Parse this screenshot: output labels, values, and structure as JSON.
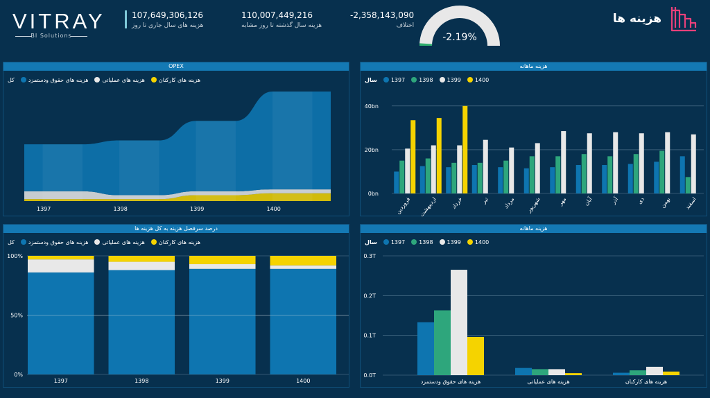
{
  "header": {
    "logo_text": "VITRAY",
    "logo_sub": "BI Solutions",
    "page_title": "هزینه ها",
    "kpis": [
      {
        "value": "107,649,306,126",
        "label": "هزینه های سال جاری تا روز"
      },
      {
        "value": "110,007,449,216",
        "label": "هزینه سال گذشته تا روز مشابه"
      },
      {
        "value": "-2,358,143,090",
        "label": "اختلاف"
      }
    ],
    "gauge": {
      "value_text": "-2.19%",
      "fill_fraction": 0.02,
      "track_color": "#e8e8e8",
      "fill_color": "#2fae6f"
    }
  },
  "colors": {
    "p1397": "#0e75b0",
    "p1398": "#2ea67c",
    "p1399": "#e8e8e8",
    "p1400": "#f5d300",
    "salary": "#0e75b0",
    "ops": "#e8e8e8",
    "staff": "#f5d300"
  },
  "opex": {
    "title": "OPEX",
    "legend": [
      {
        "label": "کل",
        "color": ""
      },
      {
        "label": "هزینه های حقوق ودستمزد",
        "color": "#0e75b0"
      },
      {
        "label": "هزینه های عملیاتی",
        "color": "#e8e8e8"
      },
      {
        "label": "هزینه های کارکنان",
        "color": "#f5d300"
      }
    ],
    "chart_data": {
      "type": "area",
      "categories": [
        "1397",
        "1398",
        "1399",
        "1400"
      ],
      "series": [
        {
          "name": "هزینه های حقوق ودستمزد",
          "values": [
            0.12,
            0.14,
            0.18,
            0.25
          ]
        },
        {
          "name": "هزینه های عملیاتی",
          "values": [
            0.02,
            0.01,
            0.01,
            0.01
          ]
        },
        {
          "name": "هزینه های کارکنان",
          "values": [
            0.005,
            0.005,
            0.015,
            0.02
          ]
        }
      ]
    }
  },
  "monthly1": {
    "title": "هزینه ماهانه",
    "legend_title": "سال",
    "legend": [
      {
        "label": "1397",
        "color": "#0e75b0"
      },
      {
        "label": "1398",
        "color": "#2ea67c"
      },
      {
        "label": "1399",
        "color": "#e8e8e8"
      },
      {
        "label": "1400",
        "color": "#f5d300"
      }
    ],
    "chart_data": {
      "type": "bar",
      "categories": [
        "فروردین",
        "اردیبهشت",
        "خرداد",
        "تیر",
        "مرداد",
        "شهریور",
        "مهر",
        "آبان",
        "آذر",
        "دی",
        "بهمن",
        "اسفند"
      ],
      "series": [
        {
          "name": "1397",
          "values": [
            10,
            12.5,
            12,
            13,
            12,
            11.5,
            12,
            13,
            13,
            13.5,
            14.5,
            17
          ]
        },
        {
          "name": "1398",
          "values": [
            15,
            16,
            14,
            14,
            15,
            17,
            17,
            18,
            17,
            18,
            19.5,
            7.5
          ]
        },
        {
          "name": "1399",
          "values": [
            20.5,
            22,
            22,
            24.5,
            21,
            23,
            28.5,
            27.5,
            28,
            27.5,
            28,
            27
          ]
        },
        {
          "name": "1400",
          "values": [
            33.5,
            34.5,
            40,
            0,
            0,
            0,
            0,
            0,
            0,
            0,
            0,
            0
          ]
        }
      ],
      "yticks": [
        "0bn",
        "20bn",
        "40bn"
      ],
      "ylim": [
        0,
        45
      ]
    }
  },
  "percent": {
    "title": "درصد سرفصل هزینه به کل هزینه ها",
    "legend": [
      {
        "label": "کل",
        "color": ""
      },
      {
        "label": "هزینه های حقوق ودستمزد",
        "color": "#0e75b0"
      },
      {
        "label": "هزینه های عملیاتی",
        "color": "#e8e8e8"
      },
      {
        "label": "هزینه های کارکنان",
        "color": "#f5d300"
      }
    ],
    "chart_data": {
      "type": "bar",
      "categories": [
        "1397",
        "1398",
        "1399",
        "1400"
      ],
      "series": [
        {
          "name": "هزینه های حقوق ودستمزد",
          "values": [
            86,
            88,
            89,
            89
          ]
        },
        {
          "name": "هزینه های عملیاتی",
          "values": [
            11,
            7,
            4,
            3
          ]
        },
        {
          "name": "هزینه های کارکنان",
          "values": [
            3,
            5,
            7,
            8
          ]
        }
      ],
      "yticks": [
        "0%",
        "50%",
        "100%"
      ]
    }
  },
  "monthly2": {
    "title": "هزینه ماهانه",
    "legend_title": "سال",
    "legend": [
      {
        "label": "1397",
        "color": "#0e75b0"
      },
      {
        "label": "1398",
        "color": "#2ea67c"
      },
      {
        "label": "1399",
        "color": "#e8e8e8"
      },
      {
        "label": "1400",
        "color": "#f5d300"
      }
    ],
    "chart_data": {
      "type": "bar",
      "categories": [
        "هزینه های حقوق ودستمزد",
        "هزینه های عملیاتی",
        "هزینه های کارکنان"
      ],
      "series": [
        {
          "name": "1397",
          "values": [
            0.133,
            0.018,
            0.006
          ]
        },
        {
          "name": "1398",
          "values": [
            0.163,
            0.015,
            0.012
          ]
        },
        {
          "name": "1399",
          "values": [
            0.265,
            0.015,
            0.021
          ]
        },
        {
          "name": "1400",
          "values": [
            0.096,
            0.005,
            0.009
          ]
        }
      ],
      "yticks": [
        "0.0T",
        "0.1T",
        "0.2T",
        "0.3T"
      ],
      "ylim": [
        0,
        0.3
      ]
    }
  }
}
